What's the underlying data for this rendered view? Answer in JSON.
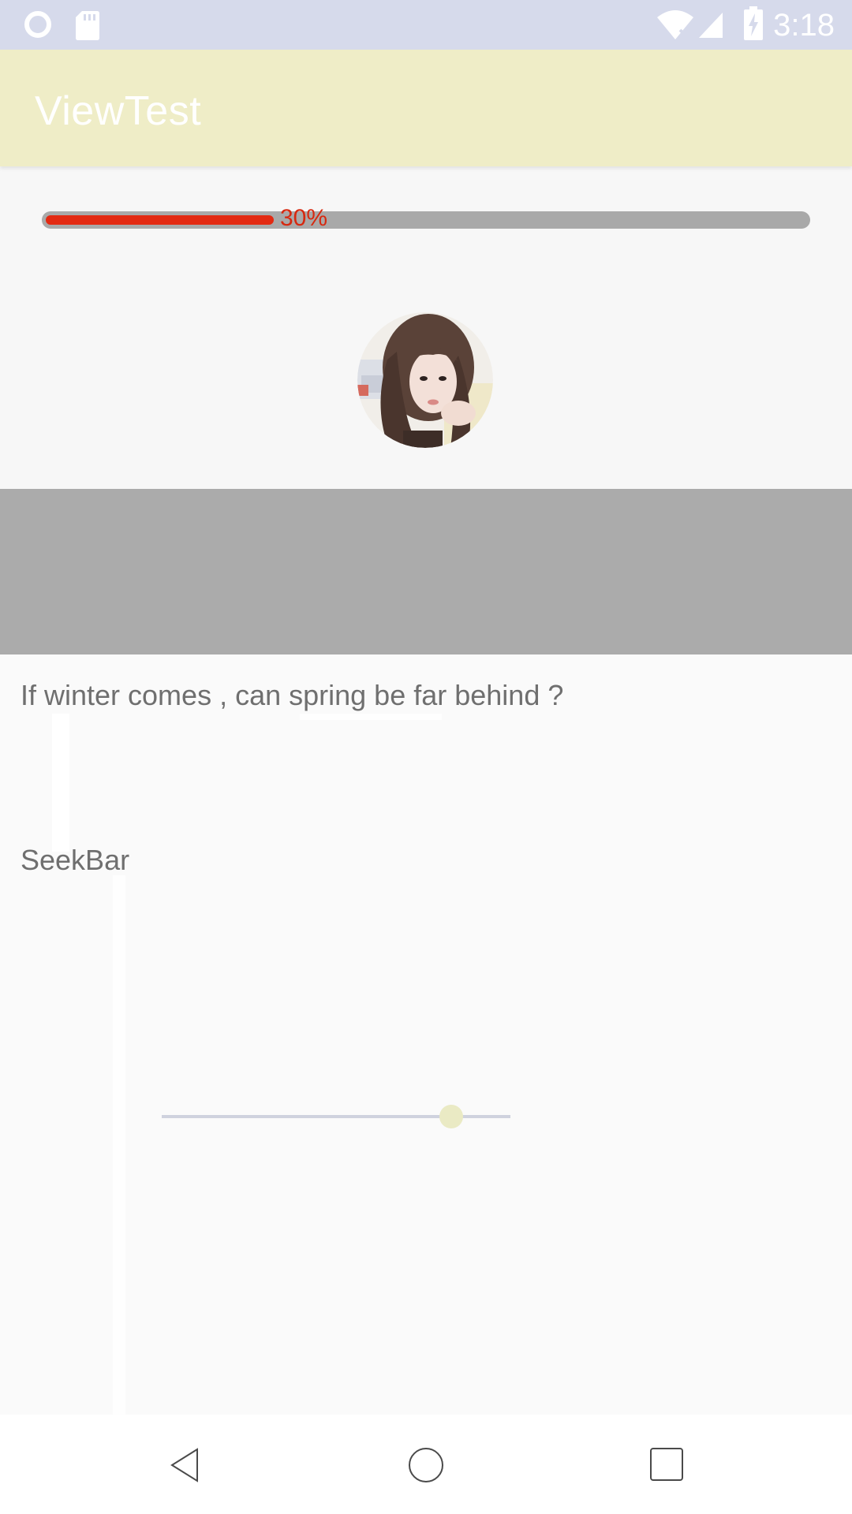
{
  "status_bar": {
    "time": "3:18",
    "icons": [
      "circle-notification-icon",
      "sd-card-icon",
      "wifi-off-icon",
      "signal-icon",
      "battery-charging-icon"
    ],
    "background": "#d6daeb"
  },
  "app_bar": {
    "title": "ViewTest",
    "background": "#efedc7"
  },
  "progress": {
    "value": 0.3,
    "label": "30%",
    "fill_color": "#e32a12",
    "track_color": "#a9a9a9"
  },
  "avatar": {
    "icon": "avatar-photo"
  },
  "content": {
    "quote": "If winter comes , can spring be far behind ?",
    "seekbar_label": "SeekBar"
  },
  "seekbar": {
    "value": 0.83,
    "thumb_color": "#eaeac4",
    "track_color": "#cfd2de"
  },
  "nav_bar": {
    "icons": [
      "back-icon",
      "home-icon",
      "recents-icon"
    ]
  }
}
